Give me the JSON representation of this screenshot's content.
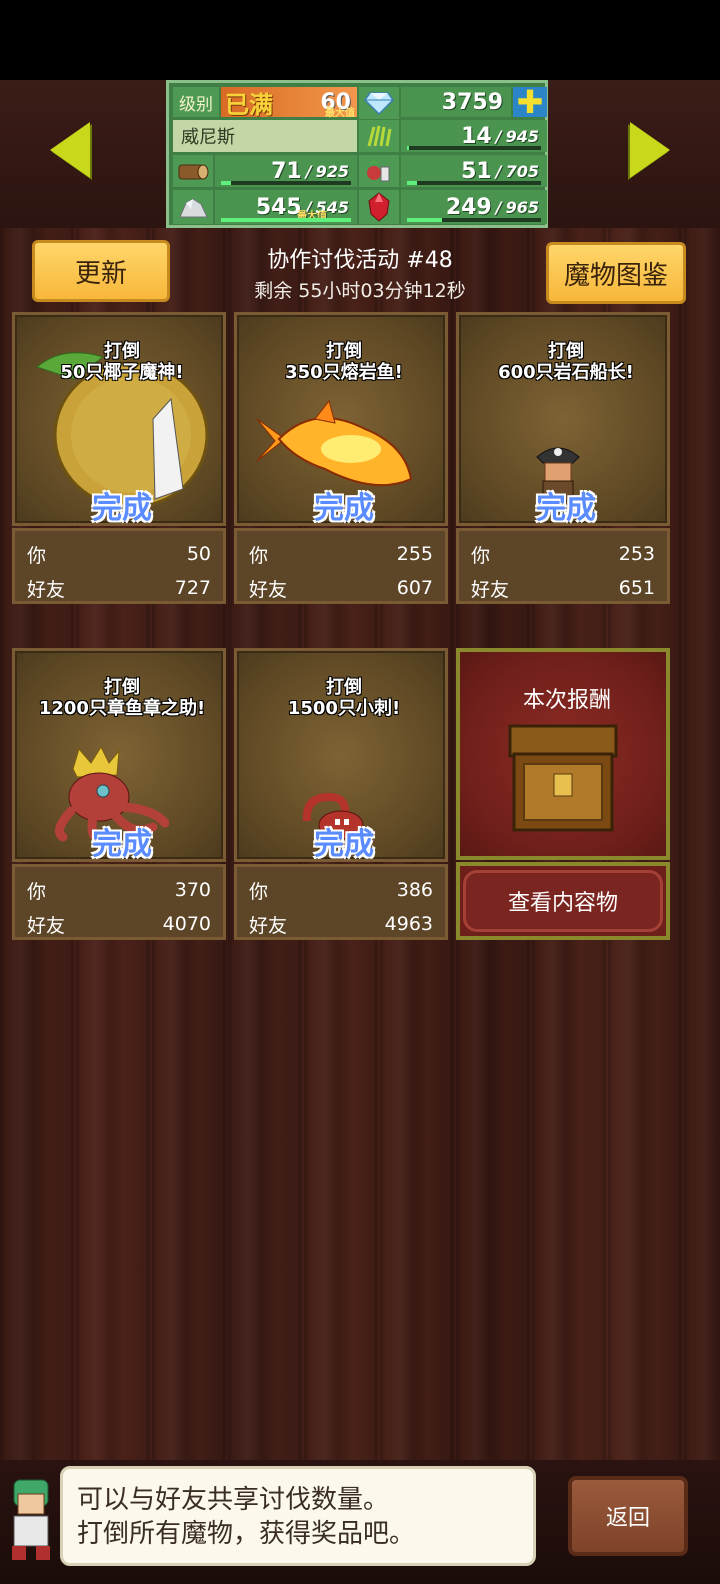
{
  "status": {
    "level_label": "级别",
    "level_maxed": "已满",
    "level_value": "60",
    "max_tag": "最大值",
    "gems": "3759",
    "plus_symbol": "✚",
    "player_name": "威尼斯",
    "grass": {
      "value": "14",
      "sep": "/",
      "max": "945",
      "progress": 0.015
    },
    "wood": {
      "value": "71",
      "sep": "/",
      "max": "925",
      "progress": 0.077
    },
    "food": {
      "value": "51",
      "sep": "/",
      "max": "705",
      "progress": 0.072
    },
    "stone": {
      "value": "545",
      "sep": "/",
      "max": "545",
      "max_tag": "最大值",
      "progress": 1.0
    },
    "ruby": {
      "value": "249",
      "sep": "/",
      "max": "965",
      "progress": 0.258
    }
  },
  "header": {
    "update_label": "更新",
    "event_title": "协作讨伐活动 #48",
    "timer": "剩余 55小时03分钟12秒",
    "dex_label": "魔物图鉴"
  },
  "labels": {
    "you": "你",
    "friends": "好友",
    "done": "完成"
  },
  "cards": [
    {
      "line1": "打倒",
      "line2": "50只椰子魔神!",
      "you": "50",
      "friends": "727"
    },
    {
      "line1": "打倒",
      "line2": "350只熔岩鱼!",
      "you": "255",
      "friends": "607"
    },
    {
      "line1": "打倒",
      "line2": "600只岩石船长!",
      "you": "253",
      "friends": "651"
    },
    {
      "line1": "打倒",
      "line2": "1200只章鱼章之助!",
      "you": "370",
      "friends": "4070"
    },
    {
      "line1": "打倒",
      "line2": "1500只小刺!",
      "you": "386",
      "friends": "4963"
    }
  ],
  "reward": {
    "title": "本次报酬",
    "button": "查看内容物"
  },
  "footer": {
    "message_line1": "可以与好友共享讨伐数量。",
    "message_line2": "打倒所有魔物，获得奖品吧。",
    "back_label": "返回"
  },
  "icons": {
    "nav_left": "arrow-left-icon",
    "nav_right": "arrow-right-icon",
    "gem": "diamond-icon",
    "grass": "grass-icon",
    "wood": "log-icon",
    "food": "vegetable-icon",
    "stone": "ore-icon",
    "ruby": "ruby-icon"
  },
  "colors": {
    "nav_arrow": "#c9d81a",
    "done_text": "#5b8cff",
    "button_yellow": "#f7b73a"
  }
}
